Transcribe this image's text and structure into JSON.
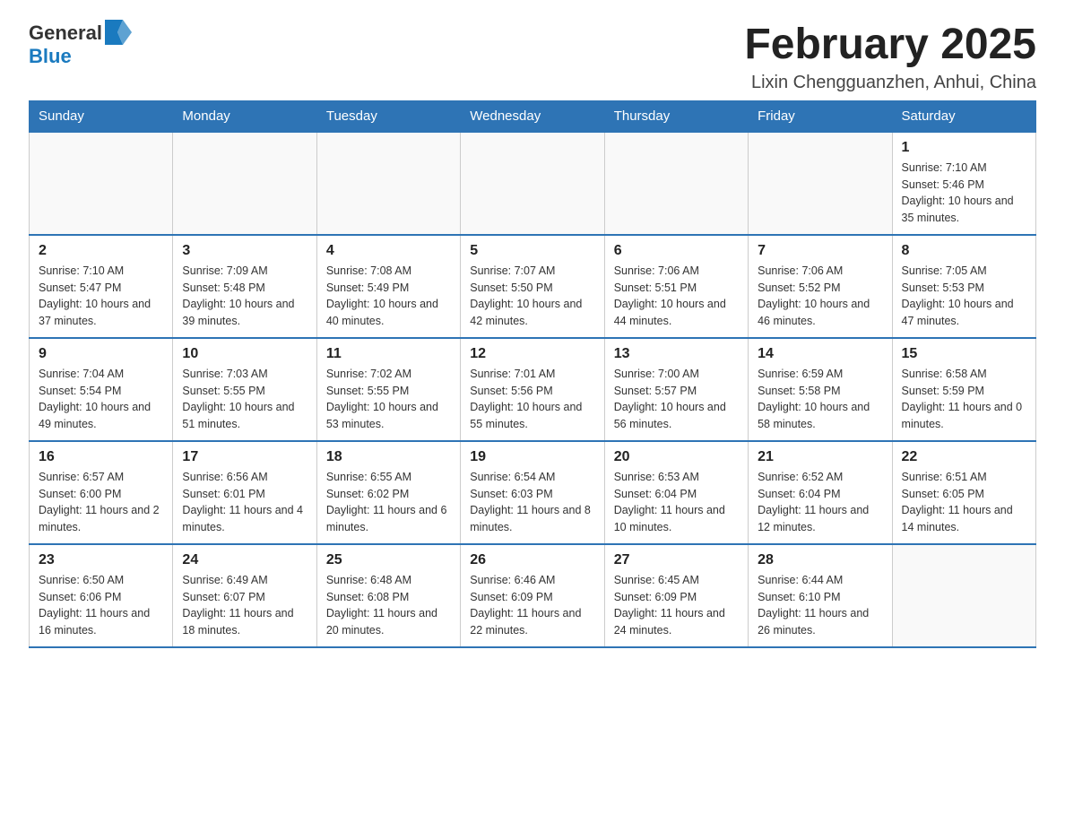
{
  "header": {
    "logo_general": "General",
    "logo_blue": "Blue",
    "month_title": "February 2025",
    "location": "Lixin Chengguanzhen, Anhui, China"
  },
  "weekdays": [
    "Sunday",
    "Monday",
    "Tuesday",
    "Wednesday",
    "Thursday",
    "Friday",
    "Saturday"
  ],
  "weeks": [
    [
      {
        "day": "",
        "sunrise": "",
        "sunset": "",
        "daylight": ""
      },
      {
        "day": "",
        "sunrise": "",
        "sunset": "",
        "daylight": ""
      },
      {
        "day": "",
        "sunrise": "",
        "sunset": "",
        "daylight": ""
      },
      {
        "day": "",
        "sunrise": "",
        "sunset": "",
        "daylight": ""
      },
      {
        "day": "",
        "sunrise": "",
        "sunset": "",
        "daylight": ""
      },
      {
        "day": "",
        "sunrise": "",
        "sunset": "",
        "daylight": ""
      },
      {
        "day": "1",
        "sunrise": "Sunrise: 7:10 AM",
        "sunset": "Sunset: 5:46 PM",
        "daylight": "Daylight: 10 hours and 35 minutes."
      }
    ],
    [
      {
        "day": "2",
        "sunrise": "Sunrise: 7:10 AM",
        "sunset": "Sunset: 5:47 PM",
        "daylight": "Daylight: 10 hours and 37 minutes."
      },
      {
        "day": "3",
        "sunrise": "Sunrise: 7:09 AM",
        "sunset": "Sunset: 5:48 PM",
        "daylight": "Daylight: 10 hours and 39 minutes."
      },
      {
        "day": "4",
        "sunrise": "Sunrise: 7:08 AM",
        "sunset": "Sunset: 5:49 PM",
        "daylight": "Daylight: 10 hours and 40 minutes."
      },
      {
        "day": "5",
        "sunrise": "Sunrise: 7:07 AM",
        "sunset": "Sunset: 5:50 PM",
        "daylight": "Daylight: 10 hours and 42 minutes."
      },
      {
        "day": "6",
        "sunrise": "Sunrise: 7:06 AM",
        "sunset": "Sunset: 5:51 PM",
        "daylight": "Daylight: 10 hours and 44 minutes."
      },
      {
        "day": "7",
        "sunrise": "Sunrise: 7:06 AM",
        "sunset": "Sunset: 5:52 PM",
        "daylight": "Daylight: 10 hours and 46 minutes."
      },
      {
        "day": "8",
        "sunrise": "Sunrise: 7:05 AM",
        "sunset": "Sunset: 5:53 PM",
        "daylight": "Daylight: 10 hours and 47 minutes."
      }
    ],
    [
      {
        "day": "9",
        "sunrise": "Sunrise: 7:04 AM",
        "sunset": "Sunset: 5:54 PM",
        "daylight": "Daylight: 10 hours and 49 minutes."
      },
      {
        "day": "10",
        "sunrise": "Sunrise: 7:03 AM",
        "sunset": "Sunset: 5:55 PM",
        "daylight": "Daylight: 10 hours and 51 minutes."
      },
      {
        "day": "11",
        "sunrise": "Sunrise: 7:02 AM",
        "sunset": "Sunset: 5:55 PM",
        "daylight": "Daylight: 10 hours and 53 minutes."
      },
      {
        "day": "12",
        "sunrise": "Sunrise: 7:01 AM",
        "sunset": "Sunset: 5:56 PM",
        "daylight": "Daylight: 10 hours and 55 minutes."
      },
      {
        "day": "13",
        "sunrise": "Sunrise: 7:00 AM",
        "sunset": "Sunset: 5:57 PM",
        "daylight": "Daylight: 10 hours and 56 minutes."
      },
      {
        "day": "14",
        "sunrise": "Sunrise: 6:59 AM",
        "sunset": "Sunset: 5:58 PM",
        "daylight": "Daylight: 10 hours and 58 minutes."
      },
      {
        "day": "15",
        "sunrise": "Sunrise: 6:58 AM",
        "sunset": "Sunset: 5:59 PM",
        "daylight": "Daylight: 11 hours and 0 minutes."
      }
    ],
    [
      {
        "day": "16",
        "sunrise": "Sunrise: 6:57 AM",
        "sunset": "Sunset: 6:00 PM",
        "daylight": "Daylight: 11 hours and 2 minutes."
      },
      {
        "day": "17",
        "sunrise": "Sunrise: 6:56 AM",
        "sunset": "Sunset: 6:01 PM",
        "daylight": "Daylight: 11 hours and 4 minutes."
      },
      {
        "day": "18",
        "sunrise": "Sunrise: 6:55 AM",
        "sunset": "Sunset: 6:02 PM",
        "daylight": "Daylight: 11 hours and 6 minutes."
      },
      {
        "day": "19",
        "sunrise": "Sunrise: 6:54 AM",
        "sunset": "Sunset: 6:03 PM",
        "daylight": "Daylight: 11 hours and 8 minutes."
      },
      {
        "day": "20",
        "sunrise": "Sunrise: 6:53 AM",
        "sunset": "Sunset: 6:04 PM",
        "daylight": "Daylight: 11 hours and 10 minutes."
      },
      {
        "day": "21",
        "sunrise": "Sunrise: 6:52 AM",
        "sunset": "Sunset: 6:04 PM",
        "daylight": "Daylight: 11 hours and 12 minutes."
      },
      {
        "day": "22",
        "sunrise": "Sunrise: 6:51 AM",
        "sunset": "Sunset: 6:05 PM",
        "daylight": "Daylight: 11 hours and 14 minutes."
      }
    ],
    [
      {
        "day": "23",
        "sunrise": "Sunrise: 6:50 AM",
        "sunset": "Sunset: 6:06 PM",
        "daylight": "Daylight: 11 hours and 16 minutes."
      },
      {
        "day": "24",
        "sunrise": "Sunrise: 6:49 AM",
        "sunset": "Sunset: 6:07 PM",
        "daylight": "Daylight: 11 hours and 18 minutes."
      },
      {
        "day": "25",
        "sunrise": "Sunrise: 6:48 AM",
        "sunset": "Sunset: 6:08 PM",
        "daylight": "Daylight: 11 hours and 20 minutes."
      },
      {
        "day": "26",
        "sunrise": "Sunrise: 6:46 AM",
        "sunset": "Sunset: 6:09 PM",
        "daylight": "Daylight: 11 hours and 22 minutes."
      },
      {
        "day": "27",
        "sunrise": "Sunrise: 6:45 AM",
        "sunset": "Sunset: 6:09 PM",
        "daylight": "Daylight: 11 hours and 24 minutes."
      },
      {
        "day": "28",
        "sunrise": "Sunrise: 6:44 AM",
        "sunset": "Sunset: 6:10 PM",
        "daylight": "Daylight: 11 hours and 26 minutes."
      },
      {
        "day": "",
        "sunrise": "",
        "sunset": "",
        "daylight": ""
      }
    ]
  ]
}
